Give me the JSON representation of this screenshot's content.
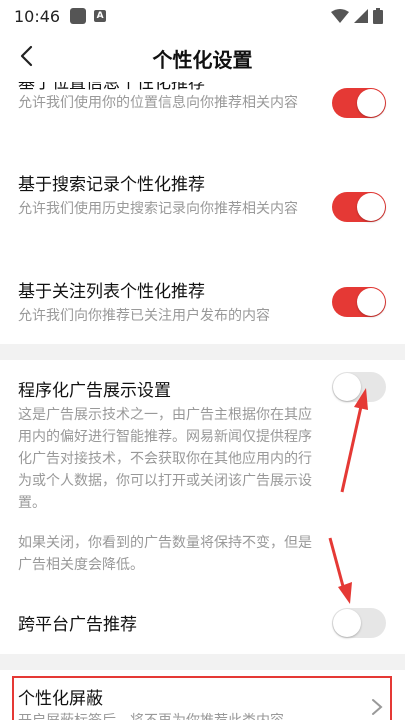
{
  "status": {
    "time": "10:46"
  },
  "nav": {
    "title": "个性化设置"
  },
  "items": [
    {
      "title": "基于位置信息个性化推荐",
      "desc": "允许我们使用你的位置信息向你推荐相关内容",
      "enabled": true
    },
    {
      "title": "基于搜索记录个性化推荐",
      "desc": "允许我们使用历史搜索记录向你推荐相关内容",
      "enabled": true
    },
    {
      "title": "基于关注列表个性化推荐",
      "desc": "允许我们向你推荐已关注用户发布的内容",
      "enabled": true
    }
  ],
  "ads": {
    "title": "程序化广告展示设置",
    "desc": "这是广告展示技术之一，由广告主根据你在其应用内的偏好进行智能推荐。网易新闻仅提供程序化广告对接技术，不会获取你在其他应用内的行为或个人数据，你可以打开或关闭该广告展示设置。",
    "note": "如果关闭，你看到的广告数量将保持不变，但是广告相关度会降低。",
    "enabled": false
  },
  "cross": {
    "title": "跨平台广告推荐",
    "enabled": false
  },
  "block": {
    "title": "个性化屏蔽",
    "desc": "开启屏蔽标签后，将不再为你推荐此类内容"
  },
  "colors": {
    "accent": "#e53935",
    "toggle_off": "#e6e6e6",
    "section_gap": "#f2f2f2"
  }
}
